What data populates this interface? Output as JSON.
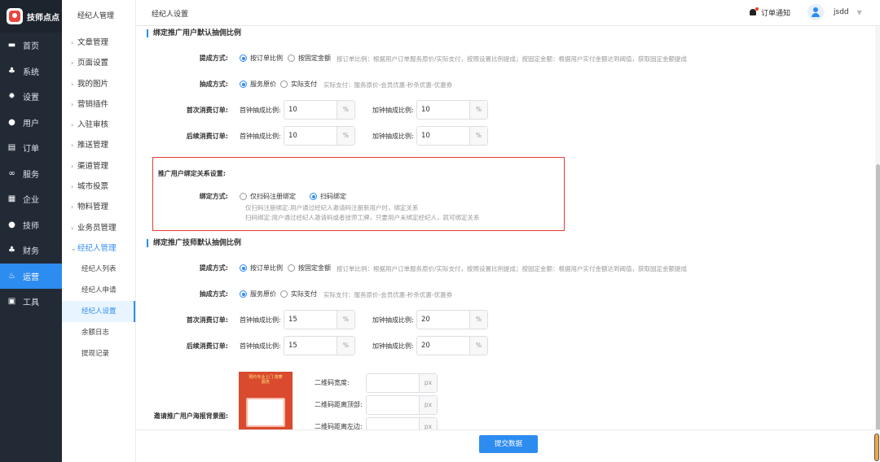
{
  "brand": {
    "name": "技师点点"
  },
  "nav": [
    {
      "label": "首页",
      "icon": "monitor-icon"
    },
    {
      "label": "系统",
      "icon": "sitemap-icon"
    },
    {
      "label": "设置",
      "icon": "gear-icon"
    },
    {
      "label": "用户",
      "icon": "user-icon"
    },
    {
      "label": "订单",
      "icon": "order-icon"
    },
    {
      "label": "服务",
      "icon": "link-icon"
    },
    {
      "label": "企业",
      "icon": "building-icon"
    },
    {
      "label": "技师",
      "icon": "user-icon"
    },
    {
      "label": "财务",
      "icon": "sitemap-icon"
    },
    {
      "label": "运营",
      "icon": "flame-icon"
    },
    {
      "label": "工具",
      "icon": "toolbox-icon"
    }
  ],
  "submenu": {
    "title": "经纪人管理",
    "items": [
      "文章管理",
      "页面设置",
      "我的图片",
      "营销插件",
      "入驻审核",
      "推送管理",
      "渠道管理",
      "城市投票",
      "物料管理",
      "业务员管理",
      "经纪人管理"
    ],
    "children": [
      "经纪人列表",
      "经纪人申请",
      "经纪人设置",
      "余额日志",
      "提现记录"
    ]
  },
  "header": {
    "breadcrumb": "经纪人设置",
    "notice": "订单通知",
    "username": "jsdd"
  },
  "common": {
    "method_label": "提成方式:",
    "by_order_ratio": "按订单比例",
    "by_fixed_amount": "按固定金额",
    "method_hint": "按订单比例：根据用户订单服务原价/实际支付，按照设置比例提成；按固定金额：根据用户实付金额达到阈值，获取固定金额提成",
    "base_label": "抽成方式:",
    "service_price": "服务原价",
    "actual_pay": "实际支付",
    "base_hint": "实际支付：服务原价-会员优惠-秒杀优惠-优惠券",
    "first_order_label": "首次消费订单:",
    "later_order_label": "后续消费订单:",
    "first_clock_ratio": "首钟抽成比例:",
    "extra_clock_ratio": "加钟抽成比例:",
    "percent_unit": "%",
    "px_unit": "px"
  },
  "section1": {
    "title": "绑定推广用户默认抽佣比例",
    "first_order": {
      "first_clock": "10",
      "extra_clock": "10"
    },
    "later_order": {
      "first_clock": "10",
      "extra_clock": "10"
    }
  },
  "binding": {
    "title": "推广用户绑定关系设置:",
    "label": "绑定方式:",
    "option_register": "仅扫码注册绑定",
    "option_scan": "扫码绑定",
    "hint1": "仅扫码注册绑定:用户通过经纪人邀请码注册新用户时，绑定关系",
    "hint2": "扫码绑定:用户通过经纪人邀请码或者技师工牌，只要用户未绑定经纪人，就可绑定关系"
  },
  "section2": {
    "title": "绑定推广技师默认抽佣比例",
    "first_order": {
      "first_clock": "15",
      "extra_clock": "20"
    },
    "later_order": {
      "first_clock": "15",
      "extra_clock": "20"
    }
  },
  "poster": {
    "label": "邀请推广用户海报背景图:",
    "image_text": "预约专业上门 按摩服务",
    "qr_width": "二维码宽度:",
    "qr_top": "二维码距离顶部:",
    "qr_left": "二维码距离左边:"
  },
  "footer": {
    "submit": "提交数据"
  },
  "colors": {
    "primary": "#2d8cf0",
    "sidebar": "#222a36",
    "highlight_border": "#e53935"
  }
}
